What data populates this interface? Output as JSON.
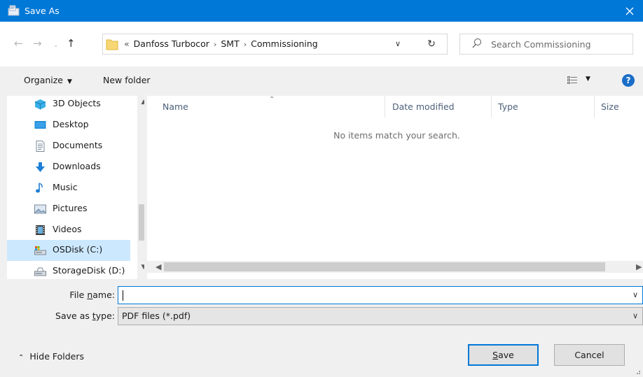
{
  "window": {
    "title": "Save As",
    "close_icon": "close-icon",
    "app_icon": "save-dialog-icon"
  },
  "address": {
    "crumb_prefix": "«",
    "crumbs": [
      "Danfoss Turbocor",
      "SMT",
      "Commissioning"
    ],
    "separator": "›"
  },
  "search": {
    "placeholder": "Search Commissioning"
  },
  "toolbar": {
    "organize_label": "Organize",
    "new_folder_label": "New folder",
    "help_label": "?"
  },
  "sidebar": {
    "items": [
      {
        "label": "3D Objects",
        "icon": "3d-objects-icon"
      },
      {
        "label": "Desktop",
        "icon": "desktop-icon"
      },
      {
        "label": "Documents",
        "icon": "documents-icon"
      },
      {
        "label": "Downloads",
        "icon": "downloads-icon"
      },
      {
        "label": "Music",
        "icon": "music-icon"
      },
      {
        "label": "Pictures",
        "icon": "pictures-icon"
      },
      {
        "label": "Videos",
        "icon": "videos-icon"
      },
      {
        "label": "OSDisk (C:)",
        "icon": "drive-icon",
        "selected": true
      },
      {
        "label": "StorageDisk (D:)",
        "icon": "drive-icon"
      }
    ]
  },
  "files": {
    "columns": [
      "Name",
      "Date modified",
      "Type",
      "Size"
    ],
    "empty_message": "No items match your search."
  },
  "form": {
    "file_name_label_pre": "File ",
    "file_name_label_ul": "n",
    "file_name_label_post": "ame:",
    "file_name_value": "",
    "save_type_label_pre": "Save as ",
    "save_type_label_ul": "t",
    "save_type_label_post": "ype:",
    "save_type_value": "PDF files (*.pdf)"
  },
  "footer": {
    "hide_folders_label": "Hide Folders",
    "save_label_ul": "S",
    "save_label_rest": "ave",
    "cancel_label": "Cancel"
  },
  "colors": {
    "accent": "#0078d7",
    "selection": "#cce8ff",
    "help": "#1a6ec8"
  }
}
